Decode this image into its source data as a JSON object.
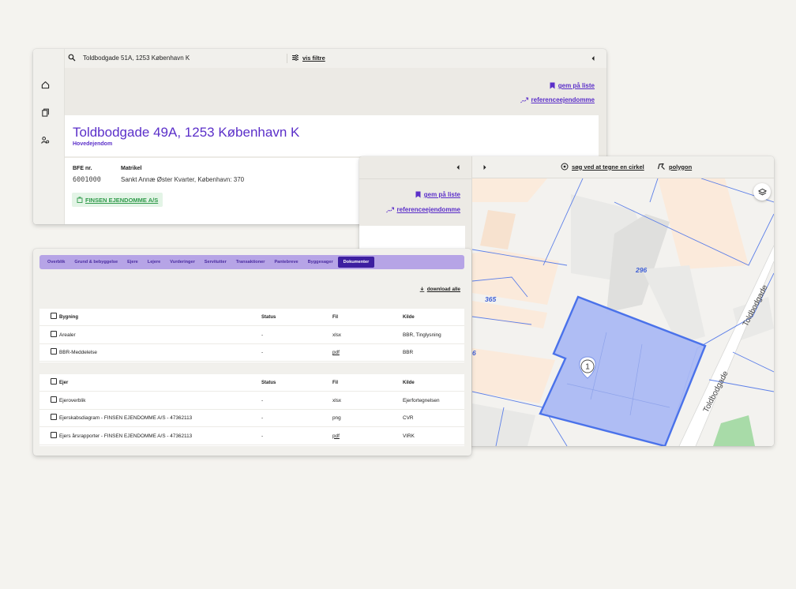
{
  "search": {
    "query": "Toldbodgade 51A, 1253 København K",
    "filter_label": "vis filtre"
  },
  "property": {
    "address": "Toldbodgade 49A, 1253 København K",
    "type": "Hovedejendom",
    "bfe_label": "BFE nr.",
    "bfe_value": "6001000",
    "matrikel_label": "Matrikel",
    "matrikel_value": "Sankt Annæ Øster Kvarter, København: 370",
    "owner": "FINSEN EJENDOMME A/S"
  },
  "actions": {
    "save_list": "gem på liste",
    "reference": "referenceejendomme",
    "download_all": "download alle",
    "draw_circle": "søg ved at tegne en cirkel",
    "polygon": "polygon"
  },
  "tabs": [
    {
      "label": "Overblik",
      "active": false
    },
    {
      "label": "Grund & bebyggelse",
      "active": false
    },
    {
      "label": "Ejere",
      "active": false
    },
    {
      "label": "Lejere",
      "active": false
    },
    {
      "label": "Vurderinger",
      "active": false
    },
    {
      "label": "Servitutter",
      "active": false
    },
    {
      "label": "Transaktioner",
      "active": false
    },
    {
      "label": "Pantebreve",
      "active": false
    },
    {
      "label": "Byggesager",
      "active": false
    },
    {
      "label": "Dokumenter",
      "active": true
    }
  ],
  "columns": {
    "status": "Status",
    "file": "Fil",
    "source": "Kilde"
  },
  "documents": {
    "groups": [
      {
        "title": "Bygning",
        "rows": [
          {
            "name": "Arealer",
            "status": "-",
            "file": "xlsx",
            "source": "BBR, Tinglysning",
            "file_link": false
          },
          {
            "name": "BBR-Meddelelse",
            "status": "-",
            "file": "pdf",
            "source": "BBR",
            "file_link": true
          }
        ]
      },
      {
        "title": "Ejer",
        "rows": [
          {
            "name": "Ejeroverblik",
            "status": "-",
            "file": "xlsx",
            "source": "Ejerfortegnelsen",
            "file_link": false
          },
          {
            "name": "Ejerskabsdiagram - FINSEN EJENDOMME A/S - 47362113",
            "status": "-",
            "file": "png",
            "source": "CVR",
            "file_link": false
          },
          {
            "name": "Ejers årsrapporter - FINSEN EJENDOMME A/S - 47362113",
            "status": "-",
            "file": "pdf",
            "source": "VIRK",
            "file_link": true
          }
        ]
      }
    ]
  },
  "map": {
    "parcel_labels": [
      "296",
      "365",
      "6"
    ],
    "street_label": "Toldbodgade",
    "marker_number": "1"
  },
  "colors": {
    "accent": "#5b2fc9",
    "tab_bar": "#b6a4e6",
    "tab_active": "#3d1fa0",
    "parcel_fill": "#a9b9f4",
    "parcel_border": "#4a72ea",
    "owner_badge_bg": "#e3f4e6",
    "owner_badge_text": "#2f9a4a"
  },
  "icons": [
    "search-icon",
    "filter-icon",
    "home-icon",
    "documents-icon",
    "users-icon",
    "bookmark-icon",
    "trend-icon",
    "download-icon",
    "circle-draw-icon",
    "polygon-icon",
    "layers-icon",
    "chevron-left-icon",
    "chevron-right-icon",
    "building-icon",
    "map-pin-icon"
  ]
}
